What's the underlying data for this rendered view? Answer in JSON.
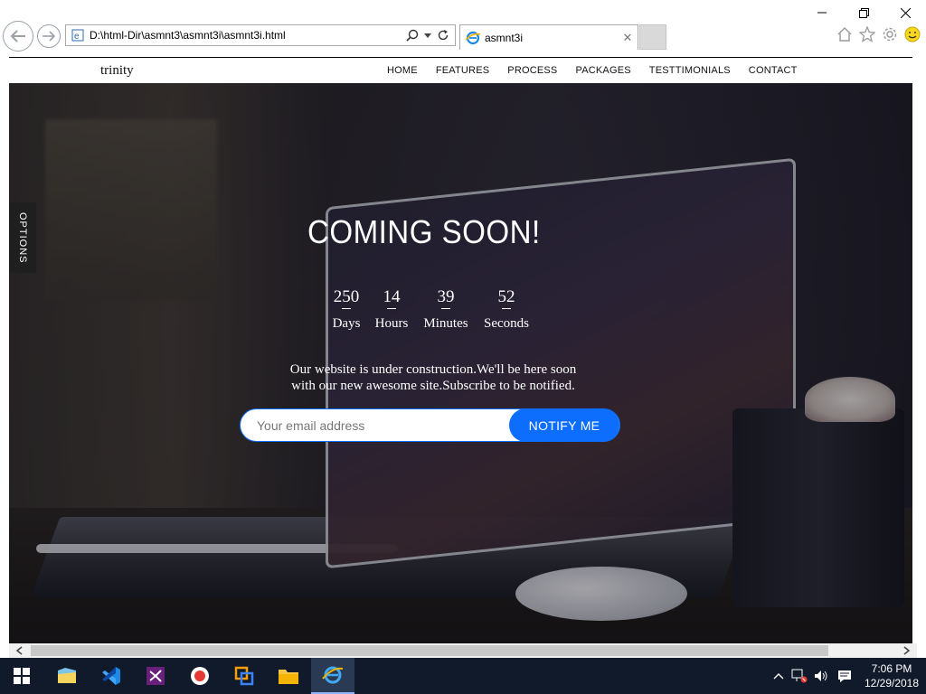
{
  "browser": {
    "address": "D:\\html-Dir\\asmnt3\\asmnt3i\\asmnt3i.html",
    "tab_title": "asmnt3i"
  },
  "site": {
    "brand": "trinity",
    "nav": [
      "HOME",
      "FEATURES",
      "PROCESS",
      "PACKAGES",
      "TESTTIMONIALS",
      "CONTACT"
    ],
    "options_label": "OPTIONS",
    "title": "COMING SOON!",
    "countdown": [
      {
        "value": "250",
        "label": "Days"
      },
      {
        "value": "14",
        "label": "Hours"
      },
      {
        "value": "39",
        "label": "Minutes"
      },
      {
        "value": "52",
        "label": "Seconds"
      }
    ],
    "message_line1": "Our website is under construction.We'll be here soon",
    "message_line2": "with our new awesome site.Subscribe to be notified.",
    "email_placeholder": "Your email address",
    "notify_label": "NOTIFY ME",
    "accent_color": "#0d6efd"
  },
  "taskbar": {
    "time": "7:06 PM",
    "date": "12/29/2018",
    "icons": [
      "windows-start-icon",
      "file-explorer-icon",
      "vscode-icon",
      "visual-studio-icon",
      "record-icon",
      "remote-icon",
      "folder-icon",
      "internet-explorer-icon"
    ]
  }
}
